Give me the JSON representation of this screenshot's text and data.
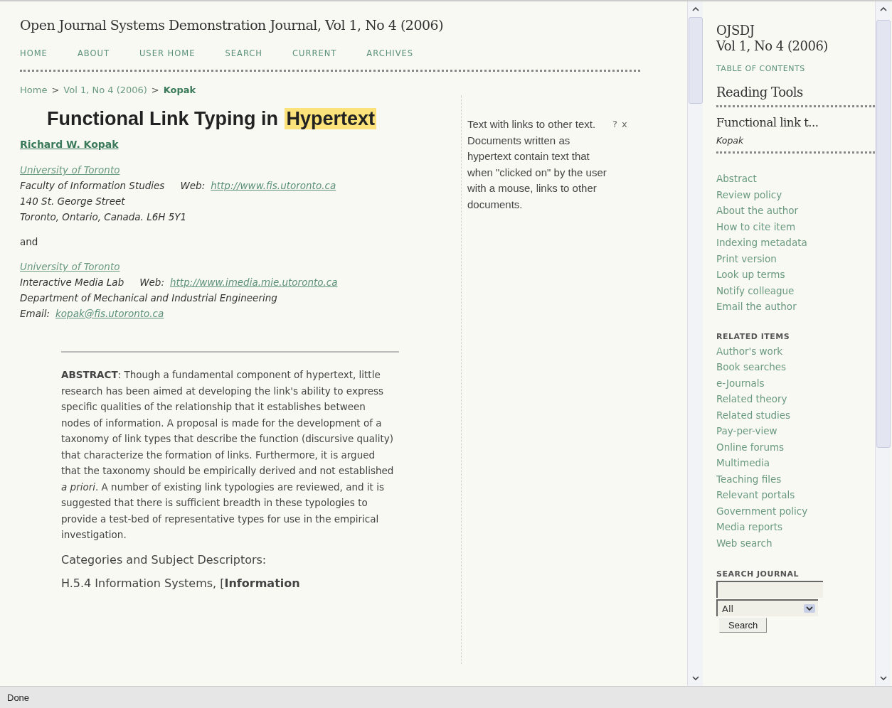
{
  "header": {
    "title": "Open Journal Systems Demonstration Journal, Vol 1, No 4 (2006)"
  },
  "nav": [
    "HOME",
    "ABOUT",
    "USER HOME",
    "SEARCH",
    "CURRENT",
    "ARCHIVES"
  ],
  "breadcrumb": [
    {
      "text": "Home",
      "current": false
    },
    {
      "text": "Vol 1, No 4 (2006)",
      "current": false
    },
    {
      "text": "Kopak",
      "current": true
    }
  ],
  "breadcrumb_separator": ">",
  "article": {
    "title": [
      {
        "text": "Functional Link Typing in ",
        "highlighted": false
      },
      {
        "text": "Hypertext",
        "highlighted": true
      }
    ],
    "author": "Richard W. Kopak",
    "affiliations": [
      {
        "university": "University of Toronto",
        "lines": [
          [
            {
              "kind": "text",
              "text": "Faculty of Information Studies"
            },
            {
              "kind": "text",
              "text": "Web:"
            },
            {
              "kind": "link",
              "text": "http://www.fis.utoronto.ca"
            }
          ],
          [
            {
              "kind": "text",
              "text": "140 St. George Street"
            }
          ],
          [
            {
              "kind": "text",
              "text": "Toronto, Ontario, Canada. L6H 5Y1"
            }
          ]
        ]
      },
      {
        "university": "University of Toronto",
        "lines": [
          [
            {
              "kind": "text",
              "text": "Interactive Media Lab"
            },
            {
              "kind": "text",
              "text": "Web:"
            },
            {
              "kind": "link",
              "text": "http://www.imedia.mie.utoronto.ca"
            }
          ],
          [
            {
              "kind": "text",
              "text": "Department of Mechanical and Industrial Engineering"
            }
          ],
          [
            {
              "kind": "text",
              "text": "Email:"
            },
            {
              "kind": "link",
              "text": "kopak@fis.utoronto.ca"
            }
          ]
        ]
      }
    ],
    "conjunction": "and",
    "abstract": "**ABSTRACT**:  Though a fundamental component of hypertext, little research has been aimed at developing the link's ability to express specific qualities of the relationship that it establishes between nodes of information. A proposal is made for the development of a taxonomy of link types that describe the function (discursive quality) that characterize the formation of links. Furthermore, it is argued that the taxonomy should be empirically derived and not established *a priori*. A number of existing link typologies are reviewed, and it is suggested that there is sufficient breadth in these typologies to provide a test-bed of representative types for use in the empirical investigation.",
    "categories_heading": "Categories and Subject Descriptors:",
    "descriptor": "H.5.4 Information Systems, [**Information**"
  },
  "glossary": {
    "definition": "Text with links to other text. Documents written as hypertext contain text that when \"clicked on\" by the user with a mouse, links to other documents.",
    "help": "?",
    "close": "x"
  },
  "sidebar": {
    "journal": "OJSDJ",
    "issue": "Vol 1, No 4 (2006)",
    "toc": "TABLE OF CONTENTS",
    "tools_heading": "Reading Tools",
    "article_title": "Functional link t...",
    "article_author": "Kopak",
    "tools": [
      "Abstract",
      "Review policy",
      "About the author",
      "How to cite item",
      "Indexing metadata",
      "Print version",
      "Look up terms",
      "Notify colleague",
      "Email the author"
    ],
    "related_heading": "RELATED ITEMS",
    "related": [
      "Author's work",
      "Book searches",
      "e-Journals",
      "Related theory",
      "Related studies",
      "Pay-per-view",
      "Online forums",
      "Multimedia",
      "Teaching files",
      "Relevant portals",
      "Government policy",
      "Media reports",
      "Web search"
    ],
    "search_heading": "SEARCH JOURNAL",
    "search_scope": "All",
    "search_button": "Search"
  },
  "status_bar": {
    "text": "Done"
  }
}
